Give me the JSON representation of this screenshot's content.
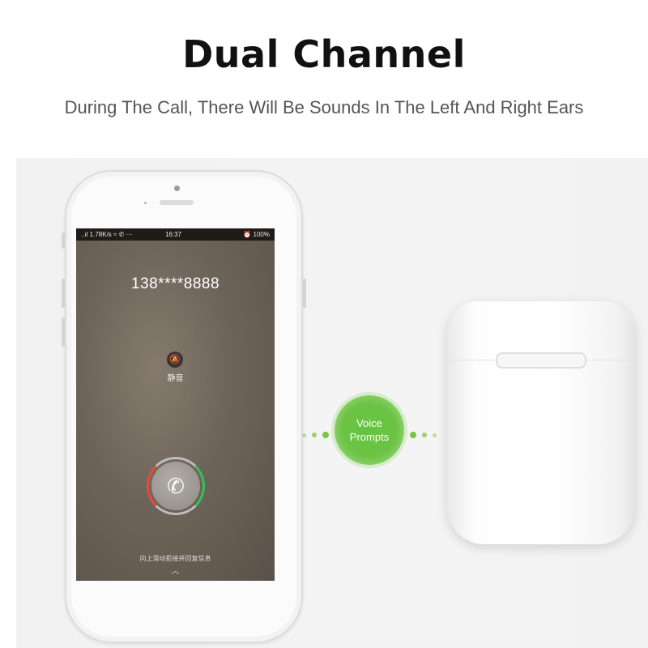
{
  "header": {
    "title": "Dual Channel",
    "subtitle": "During The Call, There Will Be Sounds In The Left And Right Ears"
  },
  "phone": {
    "status_left": "..ıl 1.78K/s ≈ ✆ ···",
    "status_time": "16:37",
    "status_right": "⏰ 100%",
    "caller_number": "138****8888",
    "mute_label": "静音",
    "slide_hint": "向上滑动拒接并回复信息",
    "icons": [
      "phone-icon",
      "mute-bell-icon",
      "chevron-up-icon"
    ]
  },
  "connector": {
    "label_line1": "Voice",
    "label_line2": "Prompts",
    "color": "#6cc345"
  }
}
